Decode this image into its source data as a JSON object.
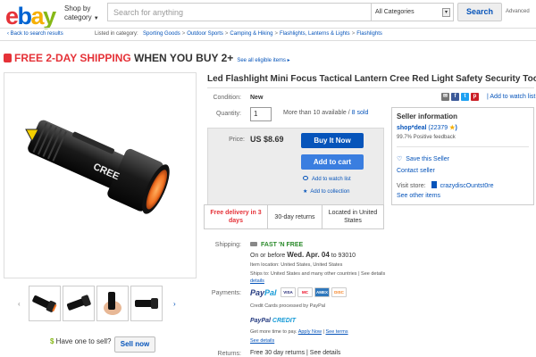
{
  "header": {
    "logo_letters": [
      "e",
      "b",
      "a",
      "y"
    ],
    "shop_by_line1": "Shop by",
    "shop_by_line2": "category",
    "search_placeholder": "Search for anything",
    "category_select": "All Categories",
    "search_button": "Search",
    "advanced": "Advanced"
  },
  "breadcrumb": {
    "back": "Back to search results",
    "listed_in": "Listed in category:",
    "items": [
      "Sporting Goods",
      "Outdoor Sports",
      "Camping & Hiking",
      "Flashlights, Lanterns & Lights",
      "Flashlights"
    ]
  },
  "promo": {
    "red": "FREE 2-DAY SHIPPING",
    "black": " WHEN YOU BUY 2+",
    "see_all": "See all eligible items ▸"
  },
  "product": {
    "title": "Led Flashlight Mini Focus Tactical Lantern Cree Red Light Safety Security Tools",
    "condition_label": "Condition:",
    "condition": "New",
    "add_to_watch_list": "Add to watch list",
    "quantity_label": "Quantity:",
    "quantity": "1",
    "available": "More than 10 available / ",
    "sold": "8 sold",
    "price_label": "Price:",
    "price": "US $8.69",
    "buy_now": "Buy It Now",
    "add_to_cart": "Add to cart",
    "watch_link": "Add to watch list",
    "collection_link": "Add to collection",
    "info": {
      "delivery": "Free delivery in 3 days",
      "returns": "30-day returns",
      "location": "Located in United States"
    }
  },
  "shipping": {
    "label": "Shipping:",
    "fast": "FAST 'N FREE",
    "eta_prefix": "On or before ",
    "eta_date": "Wed. Apr. 04",
    "eta_suffix": " to 93010",
    "item_location": "Item location: United States, United States",
    "ships_to": "Ships to: United States and many other countries | See details",
    "details": "details"
  },
  "payments": {
    "label": "Payments:",
    "paypal_a": "Pay",
    "paypal_b": "Pal",
    "cards": [
      "VISA",
      "MC",
      "AMEX",
      "DISC"
    ],
    "cc_note": "Credit Cards processed by PayPal",
    "credit_a": "PayPal",
    "credit_b": " CREDIT",
    "credit_note": "Get more time to pay. ",
    "apply": "Apply Now",
    "see_terms": "See terms",
    "see_details": "See details"
  },
  "returns": {
    "label": "Returns:",
    "value": "Free 30 day returns | See details"
  },
  "seller": {
    "header": "Seller information",
    "name": "shop*deal",
    "feedback": "(22379",
    "positive": "99.7% Positive feedback",
    "save": "Save this Seller",
    "contact": "Contact seller",
    "visit_label": "Visit store:",
    "store": "crazydiscOuntst0re",
    "other": "See other items"
  },
  "sell": {
    "question": "Have one to sell?",
    "button": "Sell now"
  },
  "colors": {
    "ebay_red": "#e53238",
    "ebay_blue": "#0064d2",
    "ebay_yellow": "#f5af02",
    "ebay_green": "#86b817",
    "link": "#0654ba",
    "buy_button": "#0654ba",
    "cart_button": "#3a7ee0"
  },
  "icons": [
    "back-chevron-icon",
    "tag-icon",
    "email-icon",
    "facebook-icon",
    "twitter-icon",
    "pinterest-icon",
    "eye-icon",
    "star-icon",
    "truck-icon",
    "heart-icon",
    "store-icon",
    "flashlight-image"
  ]
}
